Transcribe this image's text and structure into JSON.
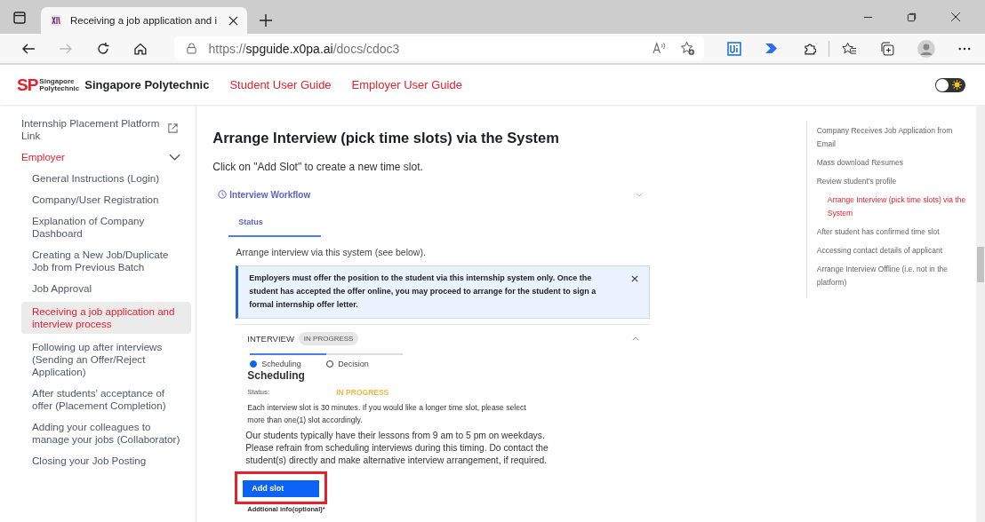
{
  "browser": {
    "tab_title": "Receiving a job application and i",
    "url_host": "spguide.x0pa.ai",
    "url_prefix": "https://",
    "url_path": "/docs/cdoc3"
  },
  "navbar": {
    "logo_mark": "SP",
    "logo_small": [
      "Singapore",
      "Polytechnic"
    ],
    "brand": "Singapore Polytechnic",
    "links": [
      "Student User Guide",
      "Employer User Guide"
    ],
    "theme_toggle": {
      "on": false
    }
  },
  "sidebar": {
    "items": [
      {
        "label": "Internship Placement Platform Link",
        "kind": "external",
        "selected": false
      },
      {
        "label": "Employer",
        "kind": "group",
        "expanded": true,
        "children": [
          {
            "label": "General Instructions (Login)",
            "selected": false
          },
          {
            "label": "Company/User Registration",
            "selected": false
          },
          {
            "label": "Explanation of Company Dashboard",
            "selected": false
          },
          {
            "label": "Creating a New Job/Duplicate Job from Previous Batch",
            "selected": false
          },
          {
            "label": "Job Approval",
            "selected": false
          },
          {
            "label": "Receiving a job application and interview process",
            "selected": true
          },
          {
            "label": "Following up after interviews (Sending an Offer/Reject Application)",
            "selected": false
          },
          {
            "label": "After students’ acceptance of offer (Placement Completion)",
            "selected": false
          },
          {
            "label": "Adding your colleagues to manage your jobs (Collaborator)",
            "selected": false
          },
          {
            "label": "Closing your Job Posting",
            "selected": false
          }
        ]
      }
    ]
  },
  "content": {
    "heading": "Arrange Interview (pick time slots) via the System",
    "intro": "Click on \"Add Slot\" to create a new time slot.",
    "screenshot": {
      "workflow_title": "Interview Workflow",
      "workflow_expanded": false,
      "tabs": [
        {
          "label": "Status",
          "selected": true
        }
      ],
      "note": "Arrange interview via this system (see below).",
      "alert": "Employers must offer the position to the student via this internship system only. Once the student has accepted the offer online, you may proceed to arrange for the student to sign a formal internship offer letter.",
      "section": {
        "title": "INTERVIEW",
        "badge": "IN PROGRESS",
        "expanded": true,
        "steps": [
          {
            "label": "Scheduling",
            "selected": true
          },
          {
            "label": "Decision",
            "selected": false
          }
        ],
        "step_title": "Scheduling",
        "status_label": "Status:",
        "status_value": "IN PROGRESS",
        "info": "Each interview slot is 30 minutes. If you would like a longer time slot, please select more than one(1) slot accordingly.",
        "notice": "Our students typically have their lessons from 9 am to 5 pm on weekdays. Please refrain from scheduling interviews during this timing. Do contact the student(s) directly and make alternative interview arrangement, if required.",
        "button": "Add slot",
        "button_highlighted": true,
        "field_label": "Addtional info(optional)*"
      }
    }
  },
  "toc": [
    {
      "label": "Company Receives Job Application from Email",
      "selected": false
    },
    {
      "label": "Mass download Resumes",
      "selected": false
    },
    {
      "label": "Review student's profile",
      "selected": false,
      "children": [
        {
          "label": "Arrange Interview (pick time slots) via the System",
          "selected": true
        }
      ]
    },
    {
      "label": "After student has confirmed time slot",
      "selected": false
    },
    {
      "label": "Accessing contact details of applicant",
      "selected": false
    },
    {
      "label": "Arrange Interview Offline (i.e. not in the platform)",
      "selected": false
    }
  ]
}
